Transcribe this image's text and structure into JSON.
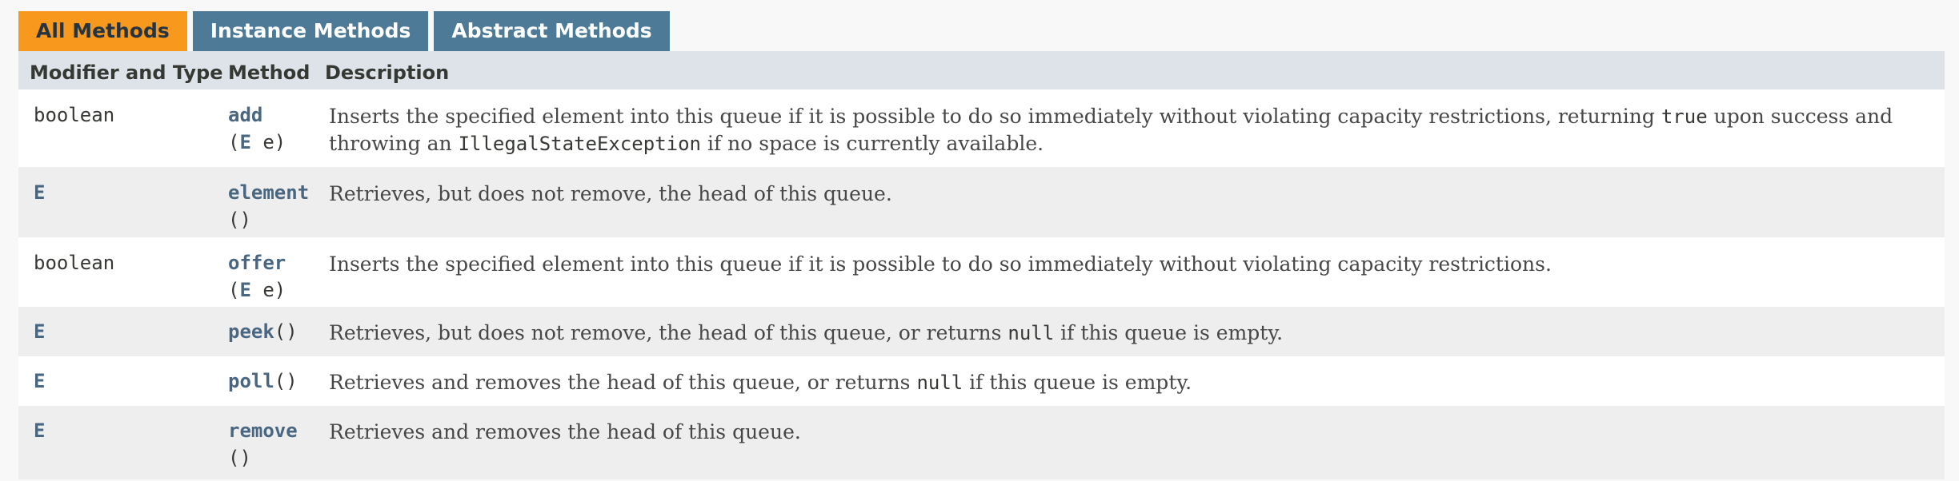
{
  "tabs": [
    {
      "label": "All Methods",
      "active": true
    },
    {
      "label": "Instance Methods",
      "active": false
    },
    {
      "label": "Abstract Methods",
      "active": false
    }
  ],
  "columns": {
    "modifier": "Modifier and Type",
    "method": "Method",
    "description": "Description"
  },
  "rows": [
    {
      "modifier": "boolean",
      "method": "add",
      "signature_open": "(",
      "param_type": "E",
      "param_name": " e)",
      "description": {
        "part1": "Inserts the specified element into this queue if it is possible to do so immediately without violating capacity restrictions, returning ",
        "code1": "true",
        "part2": " upon success and throwing an ",
        "code2": "IllegalStateException",
        "part3": " if no space is currently available."
      }
    },
    {
      "modifier": "E",
      "method": "element",
      "signature": "()",
      "description": {
        "text": "Retrieves, but does not remove, the head of this queue."
      }
    },
    {
      "modifier": "boolean",
      "method": "offer",
      "signature_open": "(",
      "param_type": "E",
      "param_name": " e)",
      "description": {
        "text": "Inserts the specified element into this queue if it is possible to do so immediately without violating capacity restrictions."
      }
    },
    {
      "modifier": "E",
      "method": "peek",
      "signature": "()",
      "description": {
        "part1": "Retrieves, but does not remove, the head of this queue, or returns ",
        "code1": "null",
        "part2": " if this queue is empty."
      }
    },
    {
      "modifier": "E",
      "method": "poll",
      "signature": "()",
      "description": {
        "part1": "Retrieves and removes the head of this queue, or returns ",
        "code1": "null",
        "part2": " if this queue is empty."
      }
    },
    {
      "modifier": "E",
      "method": "remove",
      "signature": "()",
      "description": {
        "text": "Retrieves and removes the head of this queue."
      }
    }
  ],
  "colors": {
    "tab_active": "#f8981d",
    "tab_inactive": "#4d7a97",
    "header_bg": "#dee3e9",
    "row_alt_bg": "#eeeeef",
    "link": "#4a6782"
  }
}
